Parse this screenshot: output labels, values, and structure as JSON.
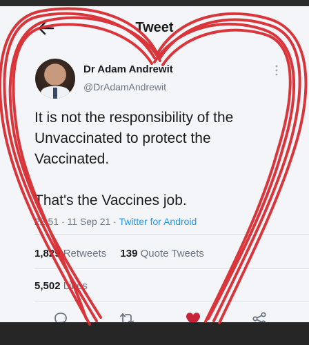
{
  "header": {
    "title": "Tweet"
  },
  "author": {
    "name": "Dr Adam Andrewit",
    "handle": "@DrAdamAndrewit"
  },
  "tweet": {
    "lines": [
      "It is not the responsibility of the",
      "Unvaccinated to protect the",
      "Vaccinated."
    ],
    "closing": "That's the Vaccines job.",
    "time": "22:51",
    "date": "11 Sep 21",
    "client": "Twitter for Android",
    "separator": "·"
  },
  "stats": {
    "retweets_count": "1,829",
    "retweets_label": "Retweets",
    "quotes_count": "139",
    "quotes_label": "Quote Tweets",
    "likes_count": "5,502",
    "likes_label": "Likes"
  },
  "icons": {
    "back": "arrow-left-icon",
    "more": "more-vertical-icon",
    "reply": "reply-icon",
    "retweet": "retweet-icon",
    "like": "heart-filled-icon",
    "share": "share-icon"
  },
  "colors": {
    "heart_drawing": "#d7262b",
    "like_active": "#c8243a",
    "link": "#1d9bf0",
    "text_secondary": "#6b7580"
  }
}
